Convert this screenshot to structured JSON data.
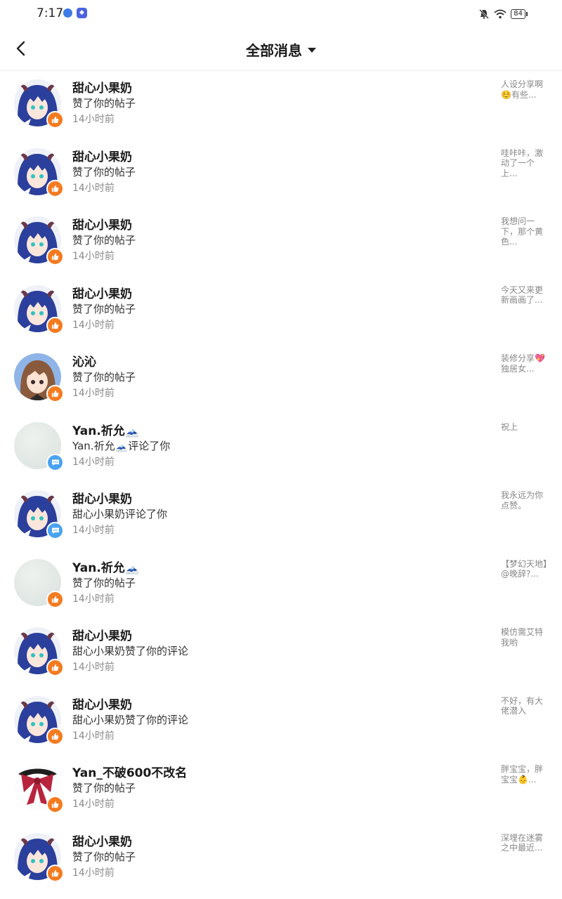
{
  "status": {
    "time": "7:17",
    "battery": "84"
  },
  "header": {
    "title": "全部消息"
  },
  "messages": [
    {
      "name": "甜心小果奶",
      "action": "赞了你的帖子",
      "time": "14小时前",
      "snippet": "人设分享啊☺️有些...",
      "type": "like",
      "avatar": "anime-blue"
    },
    {
      "name": "甜心小果奶",
      "action": "赞了你的帖子",
      "time": "14小时前",
      "snippet": "哇咔咔，激动了一个上...",
      "type": "like",
      "avatar": "anime-blue"
    },
    {
      "name": "甜心小果奶",
      "action": "赞了你的帖子",
      "time": "14小时前",
      "snippet": "我想问一下，那个黄色...",
      "type": "like",
      "avatar": "anime-blue"
    },
    {
      "name": "甜心小果奶",
      "action": "赞了你的帖子",
      "time": "14小时前",
      "snippet": "今天又来更新画画了...",
      "type": "like",
      "avatar": "anime-blue"
    },
    {
      "name": "沁沁",
      "action": "赞了你的帖子",
      "time": "14小时前",
      "snippet": "装修分享💖独居女...",
      "type": "like",
      "avatar": "anime-brown"
    },
    {
      "name": "Yan.祈允🗻",
      "action": "Yan.祈允🗻评论了你",
      "time": "14小时前",
      "snippet": "祝上",
      "type": "comment",
      "avatar": "plain"
    },
    {
      "name": "甜心小果奶",
      "action": "甜心小果奶评论了你",
      "time": "14小时前",
      "snippet": "我永远为你点赞。",
      "type": "comment",
      "avatar": "anime-blue"
    },
    {
      "name": "Yan.祈允🗻",
      "action": "赞了你的帖子",
      "time": "14小时前",
      "snippet": "【梦幻天地】@晚辞?...",
      "type": "like",
      "avatar": "plain"
    },
    {
      "name": "甜心小果奶",
      "action": "甜心小果奶赞了你的评论",
      "time": "14小时前",
      "snippet": "模仿需艾特我哟",
      "type": "like",
      "avatar": "anime-blue"
    },
    {
      "name": "甜心小果奶",
      "action": "甜心小果奶赞了你的评论",
      "time": "14小时前",
      "snippet": "不好，有大佬潜入",
      "type": "like",
      "avatar": "anime-blue"
    },
    {
      "name": "Yan_不破600不改名",
      "action": "赞了你的帖子",
      "time": "14小时前",
      "snippet": "胖宝宝，胖宝宝👶...",
      "type": "like",
      "avatar": "bow"
    },
    {
      "name": "甜心小果奶",
      "action": "赞了你的帖子",
      "time": "14小时前",
      "snippet": "深埋在迷雾之中最近...",
      "type": "like",
      "avatar": "anime-blue"
    }
  ]
}
